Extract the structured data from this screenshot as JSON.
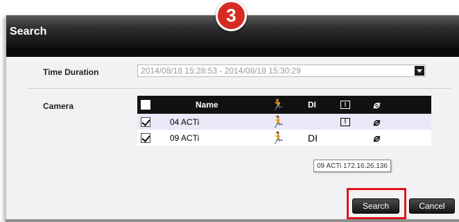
{
  "dialog": {
    "title": "Search"
  },
  "step_badge": "3",
  "time_duration": {
    "label": "Time Duration",
    "value": "2014/08/18 15:28:53 - 2014/08/18 15:30:29"
  },
  "camera": {
    "label": "Camera",
    "header": {
      "name": "Name",
      "motion_icon": "motion-icon",
      "di": "DI",
      "alarm_icon": "alarm-icon",
      "link_icon": "link-icon"
    },
    "rows": [
      {
        "checked": true,
        "name": "04 ACTi",
        "motion": true,
        "di": "",
        "alarm": true,
        "link": true
      },
      {
        "checked": true,
        "name": "09 ACTi",
        "motion": true,
        "di": "DI",
        "alarm": false,
        "link": true
      }
    ]
  },
  "tooltip": "09 ACTi 172.16.26.136",
  "buttons": {
    "search": "Search",
    "cancel": "Cancel"
  },
  "colors": {
    "highlight": "#e0151a",
    "badge": "#d62b22",
    "row_highlight": "#ebe8f7"
  }
}
